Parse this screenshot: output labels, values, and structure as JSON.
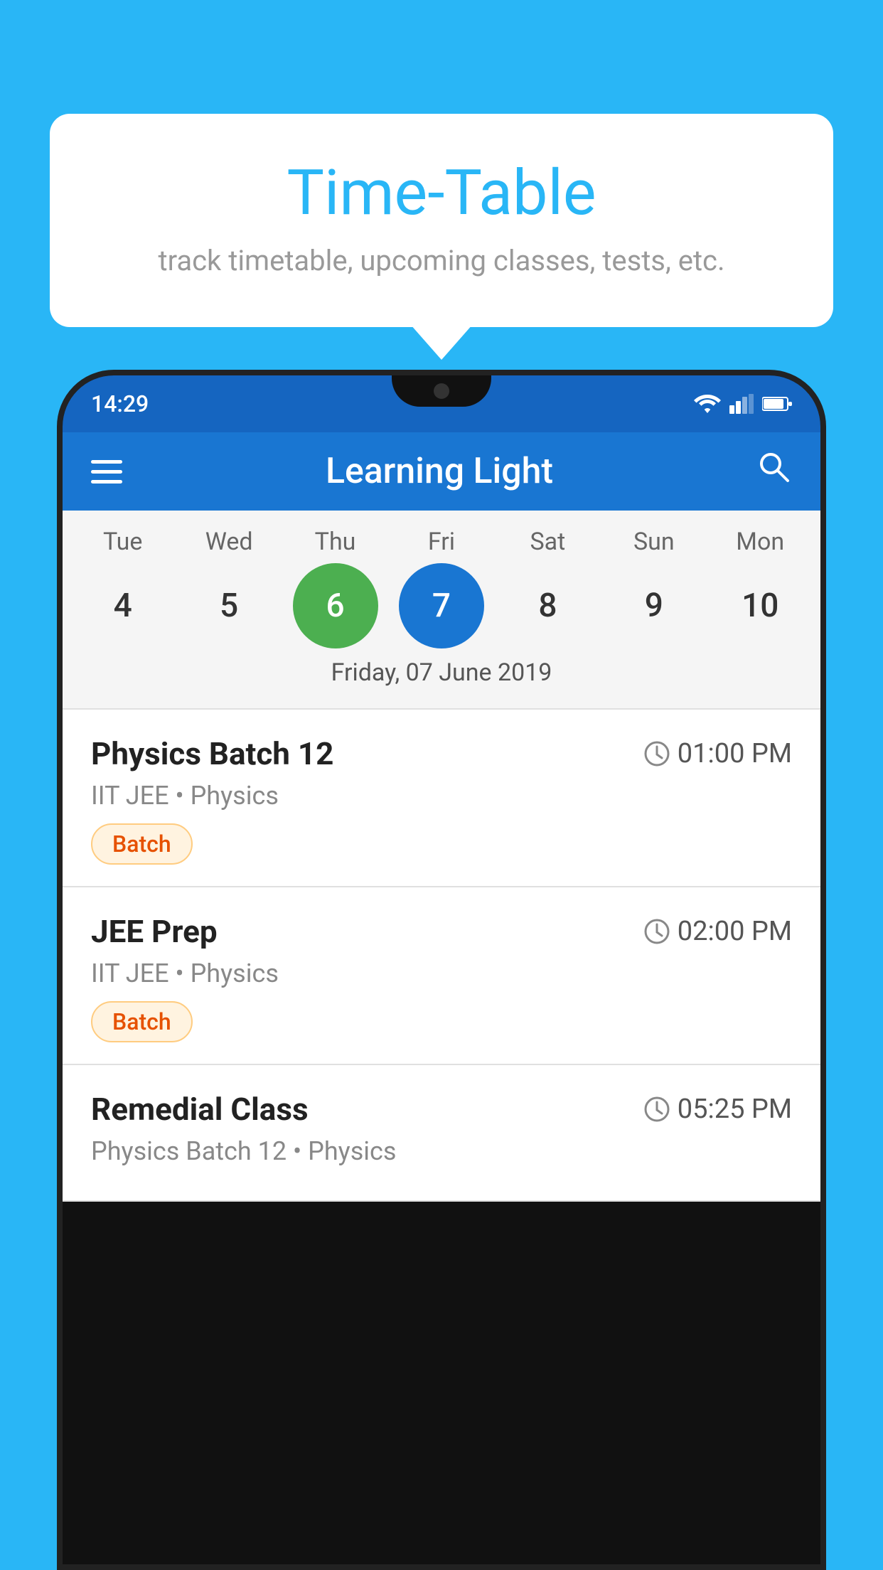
{
  "background_color": "#29b6f6",
  "tooltip": {
    "title": "Time-Table",
    "subtitle": "track timetable, upcoming classes, tests, etc."
  },
  "phone": {
    "status_bar": {
      "time": "14:29",
      "icons": [
        "wifi",
        "signal",
        "battery"
      ]
    },
    "app_bar": {
      "title": "Learning Light",
      "menu_icon": "hamburger",
      "search_icon": "search"
    },
    "calendar": {
      "days": [
        {
          "label": "Tue",
          "number": "4",
          "state": "normal"
        },
        {
          "label": "Wed",
          "number": "5",
          "state": "normal"
        },
        {
          "label": "Thu",
          "number": "6",
          "state": "today"
        },
        {
          "label": "Fri",
          "number": "7",
          "state": "selected"
        },
        {
          "label": "Sat",
          "number": "8",
          "state": "normal"
        },
        {
          "label": "Sun",
          "number": "9",
          "state": "normal"
        },
        {
          "label": "Mon",
          "number": "10",
          "state": "normal"
        }
      ],
      "selected_date_label": "Friday, 07 June 2019"
    },
    "schedule": [
      {
        "title": "Physics Batch 12",
        "time": "01:00 PM",
        "subtitle": "IIT JEE • Physics",
        "badge": "Batch"
      },
      {
        "title": "JEE Prep",
        "time": "02:00 PM",
        "subtitle": "IIT JEE • Physics",
        "badge": "Batch"
      },
      {
        "title": "Remedial Class",
        "time": "05:25 PM",
        "subtitle": "Physics Batch 12 • Physics",
        "badge": null
      }
    ]
  }
}
